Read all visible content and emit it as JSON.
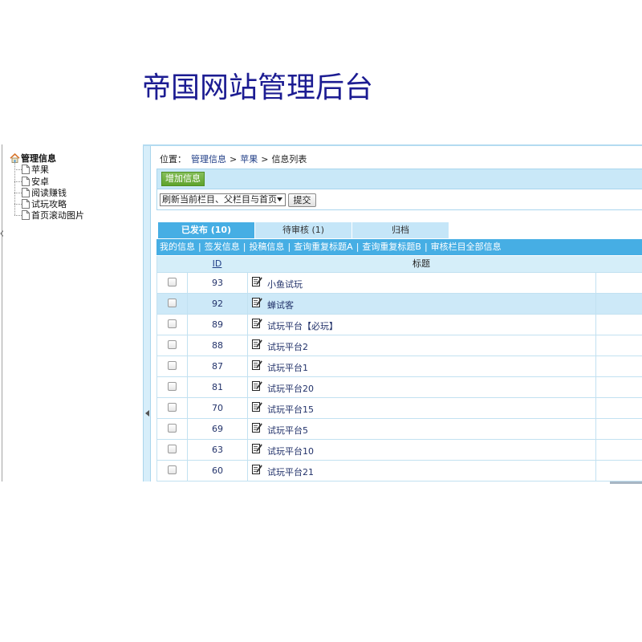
{
  "page": {
    "title": "帝国网站管理后台"
  },
  "sidebar": {
    "root": {
      "label": "管理信息",
      "icon": "home-icon"
    },
    "items": [
      {
        "label": "苹果",
        "icon": "document-icon"
      },
      {
        "label": "安卓",
        "icon": "document-icon"
      },
      {
        "label": "阅读赚钱",
        "icon": "document-icon"
      },
      {
        "label": "试玩攻略",
        "icon": "document-icon"
      },
      {
        "label": "首页滚动图片",
        "icon": "document-icon"
      }
    ]
  },
  "breadcrumb": {
    "prefix": "位置：",
    "items": [
      "管理信息",
      "苹果"
    ],
    "current": "信息列表",
    "separator": ">"
  },
  "toolbar": {
    "add_label": "增加信息",
    "refresh_option": "刷新当前栏目、父栏目与首页",
    "submit_label": "提交"
  },
  "tabs": [
    {
      "label": "已发布 (10)",
      "active": true
    },
    {
      "label": "待审核 (1)",
      "active": false
    },
    {
      "label": "归档",
      "active": false
    }
  ],
  "filter_links": {
    "separator": "|",
    "items": [
      "我的信息",
      "签发信息",
      "投稿信息",
      "查询重复标题A",
      "查询重复标题B",
      "审核栏目全部信息"
    ]
  },
  "table": {
    "headers": {
      "id": "ID",
      "title": "标题"
    },
    "rows": [
      {
        "id": 93,
        "title": "小鱼试玩"
      },
      {
        "id": 92,
        "title": "蝉试客",
        "highlighted": true
      },
      {
        "id": 89,
        "title": "试玩平台【必玩】"
      },
      {
        "id": 88,
        "title": "试玩平台2"
      },
      {
        "id": 87,
        "title": "试玩平台1"
      },
      {
        "id": 81,
        "title": "试玩平台20"
      },
      {
        "id": 70,
        "title": "试玩平台15"
      },
      {
        "id": 69,
        "title": "试玩平台5"
      },
      {
        "id": 63,
        "title": "试玩平台10"
      },
      {
        "id": 60,
        "title": "试玩平台21"
      }
    ]
  },
  "colors": {
    "title": "#1c1c92",
    "accent": "#46aee4",
    "band": "#c9e8f8",
    "add_button": "#64ad2e",
    "row_highlight": "#cde9f8",
    "link": "#1f3d86"
  }
}
